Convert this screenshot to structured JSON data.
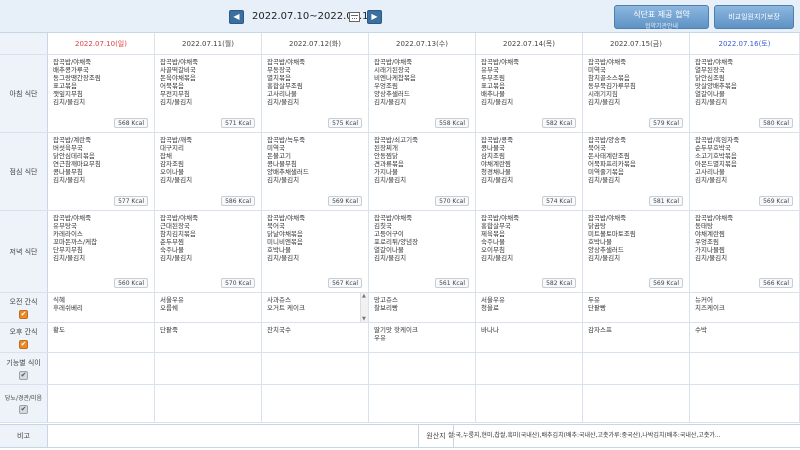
{
  "header": {
    "week_range": "2022.07.10~2022.07.16",
    "prev_icon": "chevron-left-icon",
    "next_icon": "chevron-right-icon",
    "calendar_icon": "calendar-icon",
    "supply_btn_line1": "식단표 제공 협약",
    "supply_btn_line2": "협약기관안내",
    "compare_btn": "비교일원지기보장"
  },
  "days": [
    {
      "label": "2022.07.10(일)",
      "kind": "sun"
    },
    {
      "label": "2022.07.11(월)",
      "kind": "weekday"
    },
    {
      "label": "2022.07.12(화)",
      "kind": "weekday"
    },
    {
      "label": "2022.07.13(수)",
      "kind": "weekday"
    },
    {
      "label": "2022.07.14(목)",
      "kind": "weekday"
    },
    {
      "label": "2022.07.15(금)",
      "kind": "weekday"
    },
    {
      "label": "2022.07.16(토)",
      "kind": "sat"
    }
  ],
  "rows": {
    "breakfast": {
      "label": "아침 식단",
      "cells": [
        {
          "items": [
            "잡곡밥/야채죽",
            "배추콩가루국",
            "동그랑땡간장조림",
            "표고볶음",
            "깻잎지무침",
            "김치/물김치"
          ],
          "kcal": "568 Kcal"
        },
        {
          "items": [
            "잡곡밥/야채죽",
            "사골떡갈비국",
            "돈육야채볶음",
            "어묵볶음",
            "무전지무침",
            "김치/물김치"
          ],
          "kcal": "571 Kcal"
        },
        {
          "items": [
            "잡곡밥/야채죽",
            "무동장국",
            "멸치볶음",
            "홍합살무조림",
            "고사리나물",
            "김치/물김치"
          ],
          "kcal": "575 Kcal"
        },
        {
          "items": [
            "잡곡밥/야채죽",
            "시래기된장국",
            "비엔나케찹볶음",
            "우엉조림",
            "양상추샐러드",
            "김치/물김치"
          ],
          "kcal": "558 Kcal"
        },
        {
          "items": [
            "잡곡밥/야채죽",
            "유부국",
            "두부조림",
            "표고볶음",
            "배추나물",
            "김치/물김치"
          ],
          "kcal": "582 Kcal"
        },
        {
          "items": [
            "잡곡밥/야채죽",
            "미역국",
            "참치골소스볶음",
            "동부묵김가루무침",
            "시래기지짐",
            "김치/물김치"
          ],
          "kcal": "579 Kcal"
        },
        {
          "items": [
            "잡곡밥/야채죽",
            "열무된장국",
            "닭안심조림",
            "맛살양배추볶음",
            "열갈이나물",
            "김치/물김치"
          ],
          "kcal": "580 Kcal"
        }
      ]
    },
    "lunch": {
      "label": "점심 식단",
      "cells": [
        {
          "items": [
            "잡곡밥/계란죽",
            "버섯육무국",
            "닭안심데리볶음",
            "연근참깨마요무침",
            "콩나물무침",
            "김치/물김치"
          ],
          "kcal": "577 Kcal"
        },
        {
          "items": [
            "잡곡밥/깨죽",
            "대구지리",
            "잡채",
            "감자조림",
            "오이나물",
            "김치/물김치"
          ],
          "kcal": "586 Kcal"
        },
        {
          "items": [
            "잡곡밥/녹두죽",
            "미역국",
            "돈불고기",
            "콩나물무침",
            "양배추채샐러드",
            "김치/물김치"
          ],
          "kcal": "569 Kcal"
        },
        {
          "items": [
            "잡곡밥/쇠고기죽",
            "된장찌개",
            "안동찜닭",
            "견과류볶음",
            "가지나물",
            "김치/물김치"
          ],
          "kcal": "570 Kcal"
        },
        {
          "items": [
            "잡곡밥/콩죽",
            "콩나물국",
            "삼치조림",
            "야채계란찜",
            "청경채나물",
            "김치/물김치"
          ],
          "kcal": "574 Kcal"
        },
        {
          "items": [
            "잡곡밥/양송죽",
            "북어국",
            "돈사태계란조림",
            "어묵파프리카볶음",
            "미역줄기볶음",
            "김치/물김치"
          ],
          "kcal": "581 Kcal"
        },
        {
          "items": [
            "잡곡밥/흑임자죽",
            "순두부호박국",
            "소고기호박볶음",
            "아몬드멸치볶음",
            "고사리나물",
            "김치/물김치"
          ],
          "kcal": "569 Kcal"
        }
      ]
    },
    "dinner": {
      "label": "저녁 식단",
      "cells": [
        {
          "items": [
            "잡곡밥/야채죽",
            "유부탕국",
            "카레라이스",
            "꼬마돈까스/케찹",
            "단무지무침",
            "김치/물김치"
          ],
          "kcal": "560 Kcal"
        },
        {
          "items": [
            "잡곡밥/야채죽",
            "근대된장국",
            "참치김치볶음",
            "춘두부찜",
            "숙주나물",
            "김치/물김치"
          ],
          "kcal": "570 Kcal"
        },
        {
          "items": [
            "잡곡밥/야채죽",
            "북어국",
            "닭날야채볶음",
            "미니비엔볶음",
            "호박나물",
            "김치/물김치"
          ],
          "kcal": "567 Kcal"
        },
        {
          "items": [
            "잡곡밥/야채죽",
            "김칫국",
            "고등어구이",
            "포로리튀/양념장",
            "열갈이나물",
            "김치/물김치"
          ],
          "kcal": "561 Kcal"
        },
        {
          "items": [
            "잡곡밥/야채죽",
            "홍합살무국",
            "제육볶음",
            "숙주나물",
            "오이무침",
            "김치/물김치"
          ],
          "kcal": "582 Kcal"
        },
        {
          "items": [
            "잡곡밥/야채죽",
            "닭곰탕",
            "미트볼토마토조림",
            "호박나물",
            "양상추샐러드",
            "김치/물김치"
          ],
          "kcal": "569 Kcal"
        },
        {
          "items": [
            "잡곡밥/야채죽",
            "동태탕",
            "야채계란찜",
            "우엉조림",
            "가지나물찜",
            "김치/물김치"
          ],
          "kcal": "566 Kcal"
        }
      ]
    },
    "am_snack": {
      "label": "오전 간식",
      "cells": [
        [
          "식혜",
          "후레쉬베리"
        ],
        [
          "서울우유",
          "오룹쉐"
        ],
        [
          "사과쥬스",
          "오거트 케이크"
        ],
        [
          "망고쥬스",
          "찰보리빵"
        ],
        [
          "서울우유",
          "청을료"
        ],
        [
          "두유",
          "단팥빵"
        ],
        [
          "뉴커어",
          "치즈케이크"
        ]
      ]
    },
    "pm_snack": {
      "label": "오후 간식",
      "cells": [
        [
          "황도"
        ],
        [
          "단팥죽"
        ],
        [
          "잔치국수"
        ],
        [
          "딸기맛 핫케이크",
          "우유"
        ],
        [
          "바나나"
        ],
        [
          "감자스프"
        ],
        [
          "수박"
        ]
      ]
    },
    "functional": {
      "label": "기능별 식이"
    },
    "diabetic": {
      "label": "당뇨/경관/미음"
    }
  },
  "footer": {
    "note_label": "비고",
    "note_value": "",
    "origin_label": "원산지",
    "origin_value": "쌀:국,누룽지,현미,찹쌀,흑미(국내산),배추김치(배추:국내산,고춧가루:중국산),나박김치(배추:국내산,고춧가..."
  }
}
